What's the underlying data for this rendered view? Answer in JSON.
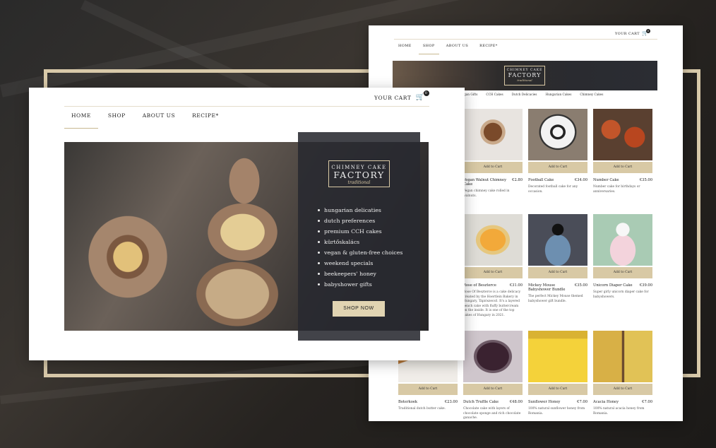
{
  "home": {
    "cart_label": "YOUR CART",
    "cart_count": "0",
    "nav": [
      "HOME",
      "SHOP",
      "ABOUT US",
      "RECIPE*"
    ],
    "logo": {
      "line1": "CHIMNEY CAKE",
      "line2": "FACTORY",
      "line3": "traditional"
    },
    "features": [
      "hungarian delicaties",
      "dutch preferences",
      "premium CCH cakes",
      "kürtőskalács",
      "vegan & gluten-free choices",
      "weekend specials",
      "beekeepers' honey",
      "babyshower gifts"
    ],
    "cta": "SHOP NOW"
  },
  "shop": {
    "cart_label": "YOUR CART",
    "cart_count": "0",
    "nav": [
      "HOME",
      "SHOP",
      "ABOUT US",
      "RECIPE*"
    ],
    "logo": {
      "line1": "CHIMNEY CAKE",
      "line2": "FACTORY",
      "line3": "traditional"
    },
    "categories": [
      "Vegan Gifts",
      "CCH Cakes",
      "Dutch Delicacies",
      "Hungarian Cakes",
      "Chimney Cakes"
    ],
    "add_to_cart": "Add to Cart",
    "products": [
      {
        "name": "Vegan Walnut Chimney Cake",
        "price": "€2.80",
        "desc": "Vegan chimney cake rolled in walnuts."
      },
      {
        "name": "Football Cake",
        "price": "€34.00",
        "desc": "Decorated football cake for any occasion."
      },
      {
        "name": "Number Cake",
        "price": "€35.00",
        "desc": "Number cake for birthdays or anniversaries."
      },
      {
        "name": "Rose of Beszterce",
        "price": "€31.00",
        "desc": "Rose Of Beszterce is a cake delicacy created by the Hoertlein Bakery in Hungary, Tápiószecső. It's a layered peach cake with fluffy buttercream on the inside. It is one of the top cakes of Hungary in 2021."
      },
      {
        "name": "Mickey Mouse Babyshower Bundle",
        "price": "€35.00",
        "desc": "The perfect Mickey Mouse themed babyshower gift bundle."
      },
      {
        "name": "Unicorn Diaper Cake",
        "price": "€39.00",
        "desc": "Super girly unicorn diaper cake for babyshowers."
      },
      {
        "name": "Boterkoek",
        "price": "€23.00",
        "desc": "Traditional dutch butter cake."
      },
      {
        "name": "Dutch Truffle Cake",
        "price": "€48.00",
        "desc": "Chocolate cake with layers of chocolate sponge and rich chocolate ganache."
      },
      {
        "name": "Sunflower Honey",
        "price": "€7.00",
        "desc": "100% natural sunflower honey from Romania."
      },
      {
        "name": "Acacia Honey",
        "price": "€7.00",
        "desc": "100% natural acacia honey from Romania."
      }
    ]
  }
}
